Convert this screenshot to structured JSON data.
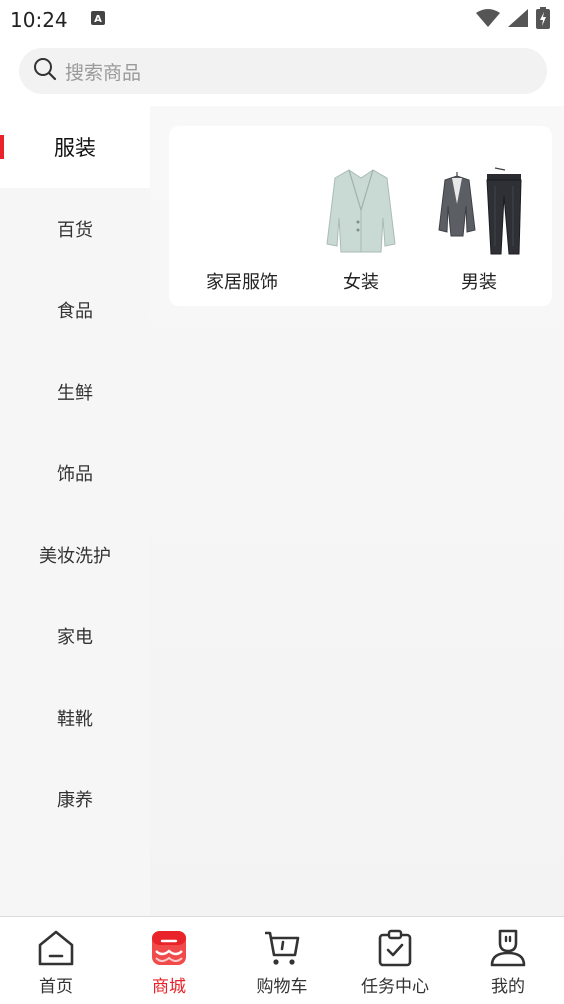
{
  "status_bar": {
    "time": "10:24"
  },
  "search": {
    "placeholder": "搜索商品"
  },
  "sidebar": {
    "items": [
      {
        "label": "服装",
        "active": true
      },
      {
        "label": "百货"
      },
      {
        "label": "食品"
      },
      {
        "label": "生鲜"
      },
      {
        "label": "饰品"
      },
      {
        "label": "美妆洗护"
      },
      {
        "label": "家电"
      },
      {
        "label": "鞋靴"
      },
      {
        "label": "康养"
      }
    ]
  },
  "subcategories": [
    {
      "label": "家居服饰",
      "icon": "empty-image"
    },
    {
      "label": "女装",
      "icon": "women-blazer-icon"
    },
    {
      "label": "男装",
      "icon": "men-suit-icon"
    }
  ],
  "bottom_nav": [
    {
      "label": "首页",
      "icon": "home-icon"
    },
    {
      "label": "商城",
      "icon": "store-icon",
      "active": true
    },
    {
      "label": "购物车",
      "icon": "cart-icon"
    },
    {
      "label": "任务中心",
      "icon": "task-clipboard-icon"
    },
    {
      "label": "我的",
      "icon": "profile-icon"
    }
  ],
  "colors": {
    "accent": "#e8232a",
    "sidebar_bg": "#f6f6f6",
    "search_bg": "#f2f2f2"
  }
}
